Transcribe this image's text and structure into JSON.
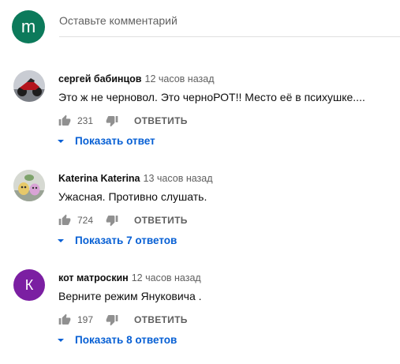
{
  "add_comment": {
    "avatar_letter": "m",
    "avatar_color": "#0c7a5b",
    "placeholder": "Оставьте комментарий"
  },
  "comments": [
    {
      "author": "сергей бабинцов",
      "time": "12 часов назад",
      "text": "Это ж не черновол. Это черноРОТ!! Место её в психушке....",
      "likes": "231",
      "reply_label": "ОТВЕТИТЬ",
      "show_replies": "Показать ответ",
      "avatar_type": "photo-motorcycle"
    },
    {
      "author": "Katerina Katerina",
      "time": "13 часов назад",
      "text": "Ужасная. Противно слушать.",
      "likes": "724",
      "reply_label": "ОТВЕТИТЬ",
      "show_replies": "Показать 7 ответов",
      "avatar_type": "photo-figurines"
    },
    {
      "author": "кот матроскин",
      "time": "12 часов назад",
      "text": "Верните режим Януковича .",
      "likes": "197",
      "reply_label": "ОТВЕТИТЬ",
      "show_replies": "Показать 8 ответов",
      "avatar_letter": "К",
      "avatar_color": "#7b1fa2"
    }
  ],
  "colors": {
    "link": "#065fd4",
    "secondary_text": "#606060"
  }
}
